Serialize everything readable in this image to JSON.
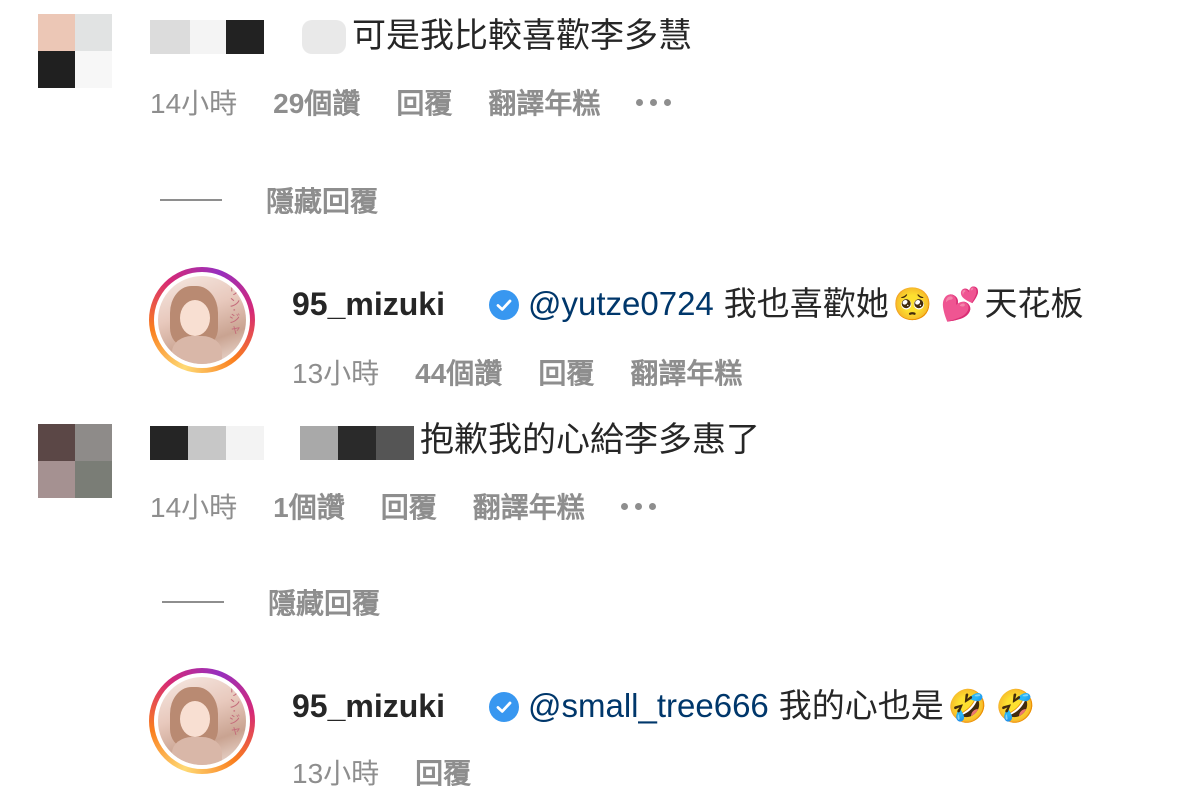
{
  "comments": [
    {
      "text": "可是我比較喜歡李多慧",
      "meta": {
        "time": "14小時",
        "likes": "29個讚",
        "reply": "回覆",
        "translate": "翻譯年糕"
      },
      "hide_replies": "隱藏回覆",
      "avatar_colors": [
        "#ecc7b6",
        "#e1e3e3",
        "#202020",
        "#f7f7f7"
      ],
      "reply": {
        "username": "95_mizuki",
        "mention": "@yutze0724",
        "text_before": "我也喜歡她",
        "emoji1": "🥺",
        "emoji2": "💕",
        "text_after": "天花板",
        "meta": {
          "time": "13小時",
          "likes": "44個讚",
          "reply": "回覆",
          "translate": "翻譯年糕"
        }
      }
    },
    {
      "text": "抱歉我的心給李多惠了",
      "meta": {
        "time": "14小時",
        "likes": "1個讚",
        "reply": "回覆",
        "translate": "翻譯年糕"
      },
      "hide_replies": "隱藏回覆",
      "avatar_colors": [
        "#5b4746",
        "#8e8b89",
        "#a59191",
        "#7a7d76"
      ],
      "reply": {
        "username": "95_mizuki",
        "mention": "@small_tree666",
        "text_before": "我的心也是",
        "emoji1": "🤣",
        "emoji2": "🤣",
        "meta": {
          "time": "13小時",
          "reply": "回覆"
        }
      }
    }
  ],
  "colors": {
    "meta_gray": "#8e8e8e",
    "mention_blue": "#00376b",
    "verified_blue": "#3897f0",
    "text": "#262626"
  }
}
